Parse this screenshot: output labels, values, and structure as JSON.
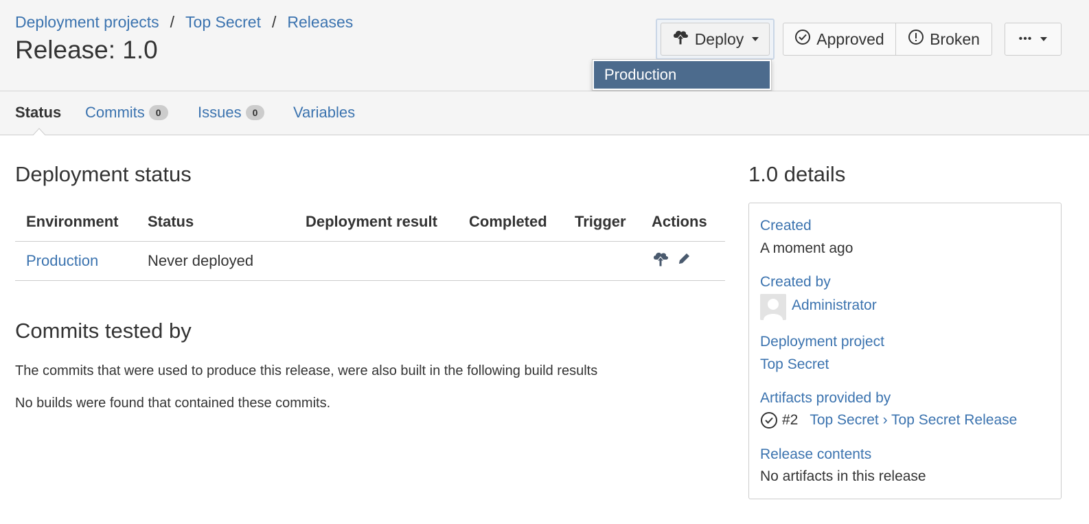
{
  "breadcrumb": {
    "items": [
      "Deployment projects",
      "Top Secret",
      "Releases"
    ],
    "separator": "/"
  },
  "page": {
    "title": "Release: 1.0"
  },
  "toolbar": {
    "deploy_label": "Deploy",
    "approved_label": "Approved",
    "broken_label": "Broken",
    "more_label": "•••"
  },
  "deploy_menu": {
    "items": [
      "Production"
    ]
  },
  "tabs": {
    "status": "Status",
    "commits": "Commits",
    "commits_count": "0",
    "issues": "Issues",
    "issues_count": "0",
    "variables": "Variables"
  },
  "deployment_status": {
    "title": "Deployment status",
    "columns": [
      "Environment",
      "Status",
      "Deployment result",
      "Completed",
      "Trigger",
      "Actions"
    ],
    "rows": [
      {
        "environment": "Production",
        "status": "Never deployed",
        "result": "",
        "completed": "",
        "trigger": ""
      }
    ]
  },
  "commits_tested": {
    "title": "Commits tested by",
    "description": "The commits that were used to produce this release, were also built in the following build results",
    "empty": "No builds were found that contained these commits."
  },
  "details": {
    "title": "1.0 details",
    "created_label": "Created",
    "created_value": "A moment ago",
    "created_by_label": "Created by",
    "created_by_value": "Administrator",
    "project_label": "Deployment project",
    "project_value": "Top Secret",
    "artifacts_label": "Artifacts provided by",
    "artifacts_build": "#2",
    "artifacts_plan": "Top Secret › Top Secret Release",
    "contents_label": "Release contents",
    "contents_value": "No artifacts in this release"
  },
  "colors": {
    "link": "#3b73af",
    "menu_highlight": "#4c6b8d",
    "header_bg": "#f5f5f5"
  }
}
